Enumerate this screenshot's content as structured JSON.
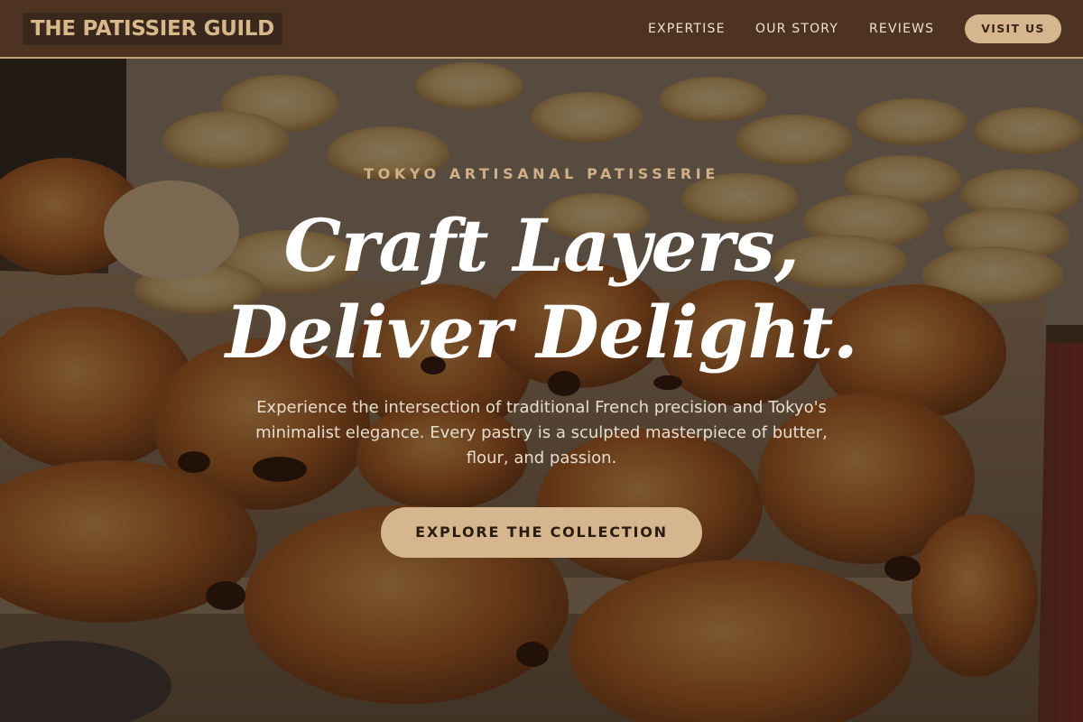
{
  "nav": {
    "logo": "THE PATISSIER GUILD",
    "links": [
      "EXPERTISE",
      "OUR STORY",
      "REVIEWS"
    ],
    "cta": "VISIT US"
  },
  "hero": {
    "eyebrow": "TOKYO ARTISANAL PATISSERIE",
    "headline_line1": "Craft Layers,",
    "headline_line2": "Deliver Delight.",
    "subtext": "Experience the intersection of traditional French precision and Tokyo's minimalist elegance. Every pastry is a sculpted masterpiece of butter, flour, and passion.",
    "cta": "EXPLORE THE COLLECTION",
    "background_image": "pastry-tray-photo"
  },
  "colors": {
    "nav_bg": "#4e3323",
    "accent": "#d5b68f",
    "nav_text": "#efe2d2",
    "eyebrow": "#cfb088",
    "headline": "#ffffff"
  }
}
